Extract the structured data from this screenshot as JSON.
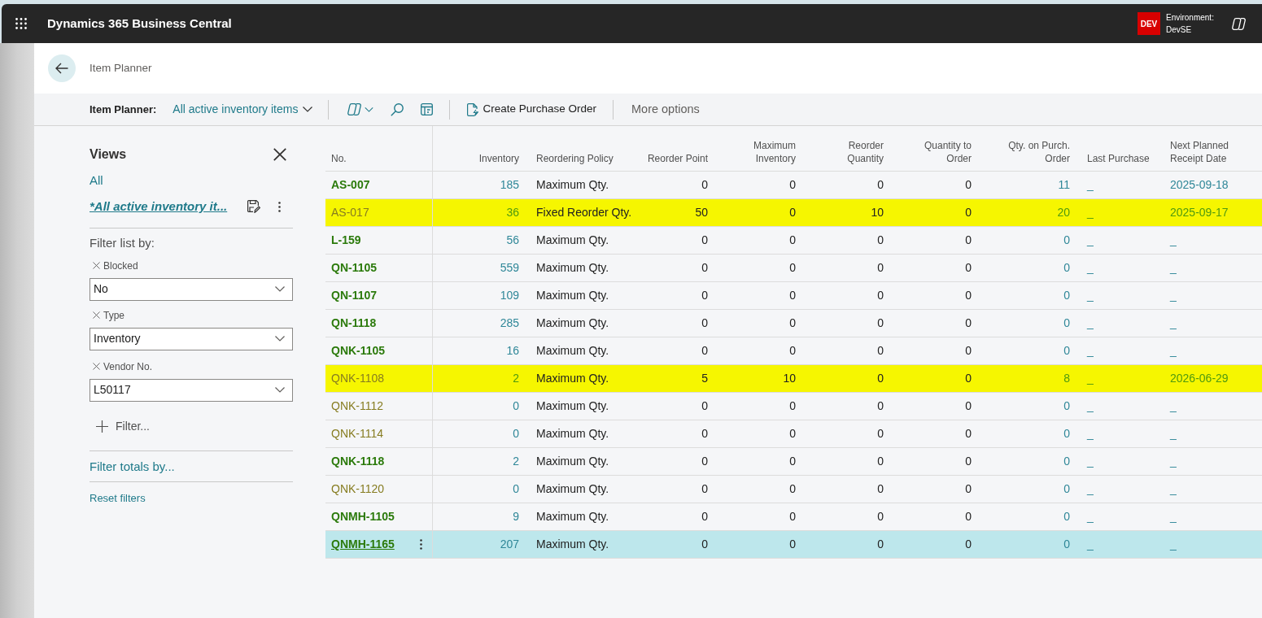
{
  "top_bar": {
    "app_name": "Dynamics 365 Business Central",
    "environment": {
      "badge": "DEV",
      "label": "Environment:",
      "name": "DevSE"
    }
  },
  "page": {
    "title": "Item Planner"
  },
  "action_bar": {
    "page_label": "Item Planner:",
    "view": "All active inventory items",
    "actions": [
      {
        "kind": "create",
        "label": "Create Purchase Order"
      },
      {
        "kind": "more",
        "label": "More options"
      }
    ]
  },
  "views_panel": {
    "title": "Views",
    "views": [
      {
        "label": "All",
        "selected": false
      },
      {
        "label": "*All active inventory it...",
        "selected": true
      }
    ],
    "filter_heading": "Filter list by:",
    "filters": [
      {
        "field": "Blocked",
        "value": "No"
      },
      {
        "field": "Type",
        "value": "Inventory"
      },
      {
        "field": "Vendor No.",
        "value": "L50117"
      }
    ],
    "add_filter": "Filter...",
    "filter_totals": "Filter totals by...",
    "reset": "Reset filters"
  },
  "table": {
    "columns": [
      "No.",
      "Inventory",
      "Reordering Policy",
      "Reorder Point",
      "Maximum Inventory",
      "Reorder Quantity",
      "Quantity to Order",
      "Qty. on Purch. Order",
      "Last Purchase",
      "Next Planned Receipt Date"
    ],
    "rows": [
      {
        "kind": "strong",
        "highlighted": false,
        "selected": false,
        "cells": [
          "AS-007",
          "185",
          "Maximum Qty.",
          "0",
          "0",
          "0",
          "0",
          "11",
          "_",
          "2025-09-18"
        ]
      },
      {
        "kind": "muted",
        "highlighted": true,
        "selected": false,
        "cells": [
          "AS-017",
          "36",
          "Fixed Reorder Qty.",
          "50",
          "0",
          "10",
          "0",
          "20",
          "_",
          "2025-09-17"
        ]
      },
      {
        "kind": "strong",
        "highlighted": false,
        "selected": false,
        "cells": [
          "L-159",
          "56",
          "Maximum Qty.",
          "0",
          "0",
          "0",
          "0",
          "0",
          "_",
          "_"
        ]
      },
      {
        "kind": "strong",
        "highlighted": false,
        "selected": false,
        "cells": [
          "QN-1105",
          "559",
          "Maximum Qty.",
          "0",
          "0",
          "0",
          "0",
          "0",
          "_",
          "_"
        ]
      },
      {
        "kind": "strong",
        "highlighted": false,
        "selected": false,
        "cells": [
          "QN-1107",
          "109",
          "Maximum Qty.",
          "0",
          "0",
          "0",
          "0",
          "0",
          "_",
          "_"
        ]
      },
      {
        "kind": "strong",
        "highlighted": false,
        "selected": false,
        "cells": [
          "QN-1118",
          "285",
          "Maximum Qty.",
          "0",
          "0",
          "0",
          "0",
          "0",
          "_",
          "_"
        ]
      },
      {
        "kind": "strong",
        "highlighted": false,
        "selected": false,
        "cells": [
          "QNK-1105",
          "16",
          "Maximum Qty.",
          "0",
          "0",
          "0",
          "0",
          "0",
          "_",
          "_"
        ]
      },
      {
        "kind": "muted",
        "highlighted": true,
        "selected": false,
        "cells": [
          "QNK-1108",
          "2",
          "Maximum Qty.",
          "5",
          "10",
          "0",
          "0",
          "8",
          "_",
          "2026-06-29"
        ]
      },
      {
        "kind": "muted",
        "highlighted": false,
        "selected": false,
        "cells": [
          "QNK-1112",
          "0",
          "Maximum Qty.",
          "0",
          "0",
          "0",
          "0",
          "0",
          "_",
          "_"
        ]
      },
      {
        "kind": "muted",
        "highlighted": false,
        "selected": false,
        "cells": [
          "QNK-1114",
          "0",
          "Maximum Qty.",
          "0",
          "0",
          "0",
          "0",
          "0",
          "_",
          "_"
        ]
      },
      {
        "kind": "strong",
        "highlighted": false,
        "selected": false,
        "cells": [
          "QNK-1118",
          "2",
          "Maximum Qty.",
          "0",
          "0",
          "0",
          "0",
          "0",
          "_",
          "_"
        ]
      },
      {
        "kind": "muted",
        "highlighted": false,
        "selected": false,
        "cells": [
          "QNK-1120",
          "0",
          "Maximum Qty.",
          "0",
          "0",
          "0",
          "0",
          "0",
          "_",
          "_"
        ]
      },
      {
        "kind": "strong",
        "highlighted": false,
        "selected": false,
        "cells": [
          "QNMH-1105",
          "9",
          "Maximum Qty.",
          "0",
          "0",
          "0",
          "0",
          "0",
          "_",
          "_"
        ]
      },
      {
        "kind": "strong",
        "highlighted": false,
        "selected": true,
        "cells": [
          "QNMH-1165",
          "207",
          "Maximum Qty.",
          "0",
          "0",
          "0",
          "0",
          "0",
          "_",
          "_"
        ]
      }
    ]
  }
}
